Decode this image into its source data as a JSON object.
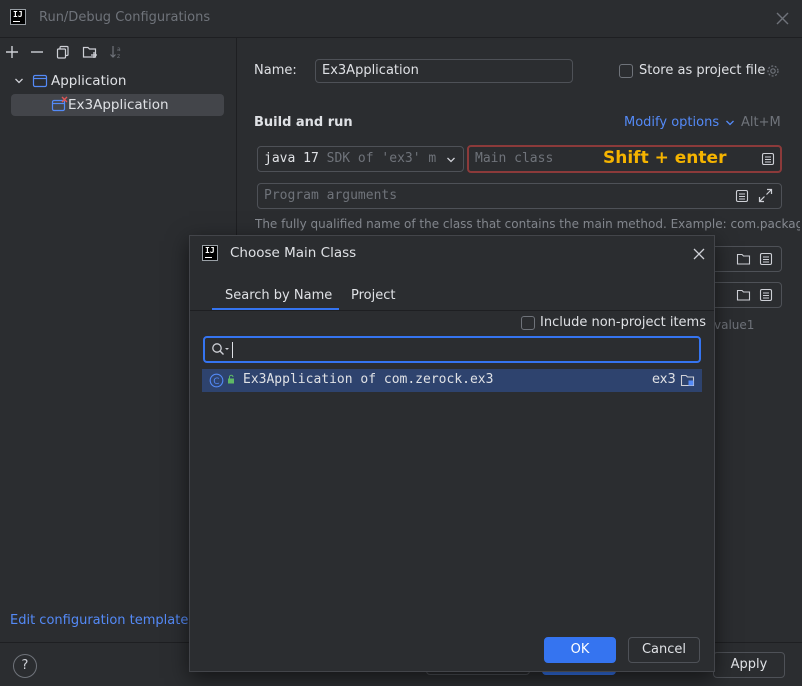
{
  "window": {
    "title": "Run/Debug Configurations"
  },
  "left_panel": {
    "toolbar_icons": [
      "add-icon",
      "remove-icon",
      "copy-icon",
      "folder-add-icon",
      "sort-icon"
    ],
    "tree": [
      {
        "label": "Application",
        "icon": "application-folder-icon",
        "expanded": true
      },
      {
        "label": "Ex3Application",
        "icon": "application-config-error-icon",
        "selected": true
      }
    ],
    "edit_templates_link": "Edit configuration templates..."
  },
  "config": {
    "name_label": "Name:",
    "name_value": "Ex3Application",
    "store_as_project_file": "Store as project file",
    "build_and_run": "Build and run",
    "modify_options": "Modify options",
    "modify_shortcut": "Alt+M",
    "sdk_strong": "java 17",
    "sdk_rest": "SDK of 'ex3' m",
    "main_class_placeholder": "Main class",
    "main_class_hint": "Shift + enter",
    "program_args_placeholder": "Program arguments",
    "help_text": "The fully qualified name of the class that contains the main method. Example: com.package.Ma",
    "partial_value": "value1"
  },
  "dialog": {
    "title": "Choose Main Class",
    "tabs": [
      {
        "label": "Search by Name",
        "active": true
      },
      {
        "label": "Project",
        "active": false
      }
    ],
    "include_non_project": "Include non-project items",
    "search_value": "",
    "results": [
      {
        "text": "Ex3Application of com.zerock.ex3",
        "module": "ex3"
      }
    ],
    "ok_label": "OK",
    "cancel_label": "Cancel"
  },
  "bottom": {
    "apply_label": "Apply",
    "help_label": "?"
  },
  "colors": {
    "accent": "#3574f0",
    "link": "#548af7",
    "error_border": "#8c3a3a",
    "hint_yellow": "#f5b400",
    "error_icon": "#e05555",
    "selection": "#2e436e"
  }
}
